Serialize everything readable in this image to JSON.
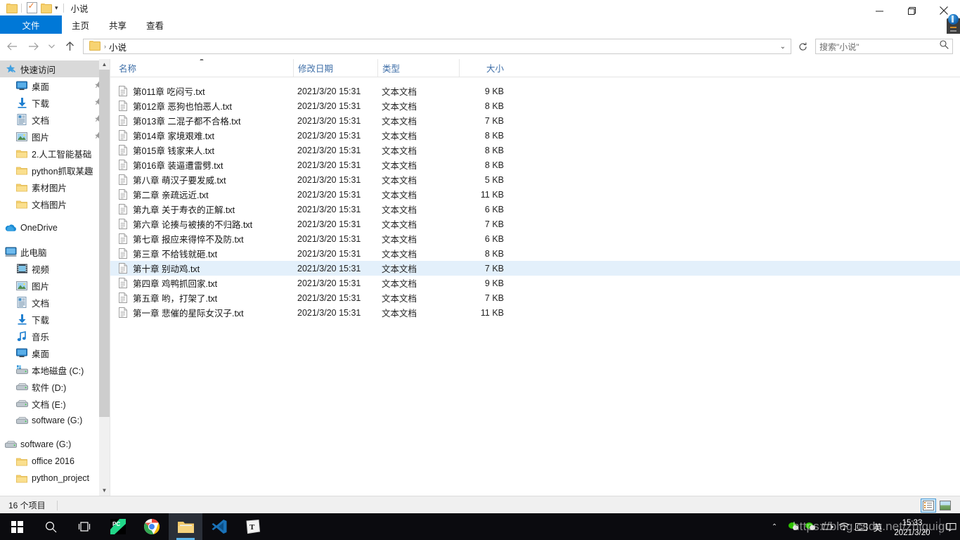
{
  "window": {
    "title": "小说",
    "quick_access_icons": [
      "folder-icon",
      "properties-checkbox-icon",
      "new-folder-icon",
      "customize-chevron-icon"
    ],
    "minimize_label": "—",
    "maximize_label": "❐",
    "close_label": "✕"
  },
  "ribbon": {
    "tabs": [
      {
        "label": "文件",
        "active": true
      },
      {
        "label": "主页",
        "active": false
      },
      {
        "label": "共享",
        "active": false
      },
      {
        "label": "查看",
        "active": false
      }
    ],
    "expand_icon": "chevron-down-icon"
  },
  "addressbar": {
    "back_icon": "arrow-left-icon",
    "forward_icon": "arrow-right-icon",
    "recent_icon": "chevron-down-icon",
    "up_icon": "arrow-up-icon",
    "breadcrumb_folder_icon": "folder-icon",
    "breadcrumb_separator": "›",
    "path": "小说",
    "dropdown_icon": "chevron-down-icon",
    "refresh_icon": "refresh-icon"
  },
  "search": {
    "placeholder": "搜索\"小说\"",
    "icon": "search-icon"
  },
  "sidebar": {
    "items": [
      {
        "label": "快速访问",
        "icon": "star-pin-icon",
        "indent": 0,
        "selected": true,
        "pinned": false
      },
      {
        "label": "桌面",
        "icon": "desktop-icon",
        "indent": 1,
        "selected": false,
        "pinned": true
      },
      {
        "label": "下载",
        "icon": "download-icon",
        "indent": 1,
        "selected": false,
        "pinned": true
      },
      {
        "label": "文档",
        "icon": "documents-icon",
        "indent": 1,
        "selected": false,
        "pinned": true
      },
      {
        "label": "图片",
        "icon": "pictures-icon",
        "indent": 1,
        "selected": false,
        "pinned": true
      },
      {
        "label": "2.人工智能基础",
        "icon": "folder-icon",
        "indent": 1,
        "selected": false,
        "pinned": false
      },
      {
        "label": "python抓取某趣",
        "icon": "folder-icon",
        "indent": 1,
        "selected": false,
        "pinned": false
      },
      {
        "label": "素材图片",
        "icon": "folder-icon",
        "indent": 1,
        "selected": false,
        "pinned": false
      },
      {
        "label": "文档图片",
        "icon": "folder-icon",
        "indent": 1,
        "selected": false,
        "pinned": false
      },
      {
        "label": "__GAP__",
        "icon": "",
        "indent": 0,
        "selected": false,
        "pinned": false
      },
      {
        "label": "OneDrive",
        "icon": "onedrive-icon",
        "indent": 0,
        "selected": false,
        "pinned": false
      },
      {
        "label": "__GAP__",
        "icon": "",
        "indent": 0,
        "selected": false,
        "pinned": false
      },
      {
        "label": "此电脑",
        "icon": "this-pc-icon",
        "indent": 0,
        "selected": false,
        "pinned": false
      },
      {
        "label": "视频",
        "icon": "videos-icon",
        "indent": 1,
        "selected": false,
        "pinned": false
      },
      {
        "label": "图片",
        "icon": "pictures-icon",
        "indent": 1,
        "selected": false,
        "pinned": false
      },
      {
        "label": "文档",
        "icon": "documents-icon",
        "indent": 1,
        "selected": false,
        "pinned": false
      },
      {
        "label": "下载",
        "icon": "download-icon",
        "indent": 1,
        "selected": false,
        "pinned": false
      },
      {
        "label": "音乐",
        "icon": "music-icon",
        "indent": 1,
        "selected": false,
        "pinned": false
      },
      {
        "label": "桌面",
        "icon": "desktop-icon",
        "indent": 1,
        "selected": false,
        "pinned": false
      },
      {
        "label": "本地磁盘 (C:)",
        "icon": "drive-system-icon",
        "indent": 1,
        "selected": false,
        "pinned": false
      },
      {
        "label": "软件 (D:)",
        "icon": "drive-icon",
        "indent": 1,
        "selected": false,
        "pinned": false
      },
      {
        "label": "文档 (E:)",
        "icon": "drive-icon",
        "indent": 1,
        "selected": false,
        "pinned": false
      },
      {
        "label": "software (G:)",
        "icon": "drive-icon",
        "indent": 1,
        "selected": false,
        "pinned": false
      },
      {
        "label": "__GAP__",
        "icon": "",
        "indent": 0,
        "selected": false,
        "pinned": false
      },
      {
        "label": "software (G:)",
        "icon": "drive-icon",
        "indent": 0,
        "selected": false,
        "pinned": false
      },
      {
        "label": "office 2016",
        "icon": "folder-icon",
        "indent": 1,
        "selected": false,
        "pinned": false
      },
      {
        "label": "python_project",
        "icon": "folder-icon",
        "indent": 1,
        "selected": false,
        "pinned": false
      }
    ],
    "scroll_up_icon": "chevron-up-icon",
    "scroll_down_icon": "chevron-down-icon"
  },
  "filelist": {
    "columns": [
      {
        "label": "名称",
        "sorted": true,
        "sort_icon": "sort-ascending-icon"
      },
      {
        "label": "修改日期",
        "sorted": false,
        "sort_icon": ""
      },
      {
        "label": "类型",
        "sorted": false,
        "sort_icon": ""
      },
      {
        "label": "大小",
        "sorted": false,
        "sort_icon": ""
      }
    ],
    "rows": [
      {
        "name": "第011章 吃闷亏.txt",
        "date": "2021/3/20 15:31",
        "type": "文本文档",
        "size": "9 KB",
        "selected": false
      },
      {
        "name": "第012章 恶狗也怕恶人.txt",
        "date": "2021/3/20 15:31",
        "type": "文本文档",
        "size": "8 KB",
        "selected": false
      },
      {
        "name": "第013章 二混子都不合格.txt",
        "date": "2021/3/20 15:31",
        "type": "文本文档",
        "size": "7 KB",
        "selected": false
      },
      {
        "name": "第014章 家境艰难.txt",
        "date": "2021/3/20 15:31",
        "type": "文本文档",
        "size": "8 KB",
        "selected": false
      },
      {
        "name": "第015章 钱家来人.txt",
        "date": "2021/3/20 15:31",
        "type": "文本文档",
        "size": "8 KB",
        "selected": false
      },
      {
        "name": "第016章 装逼遭雷劈.txt",
        "date": "2021/3/20 15:31",
        "type": "文本文档",
        "size": "8 KB",
        "selected": false
      },
      {
        "name": "第八章 萌汉子要发威.txt",
        "date": "2021/3/20 15:31",
        "type": "文本文档",
        "size": "5 KB",
        "selected": false
      },
      {
        "name": "第二章 亲疏远近.txt",
        "date": "2021/3/20 15:31",
        "type": "文本文档",
        "size": "11 KB",
        "selected": false
      },
      {
        "name": "第九章 关于寿衣的正解.txt",
        "date": "2021/3/20 15:31",
        "type": "文本文档",
        "size": "6 KB",
        "selected": false
      },
      {
        "name": "第六章 论揍与被揍的不归路.txt",
        "date": "2021/3/20 15:31",
        "type": "文本文档",
        "size": "7 KB",
        "selected": false
      },
      {
        "name": "第七章 报应来得悴不及防.txt",
        "date": "2021/3/20 15:31",
        "type": "文本文档",
        "size": "6 KB",
        "selected": false
      },
      {
        "name": "第三章 不给钱就砸.txt",
        "date": "2021/3/20 15:31",
        "type": "文本文档",
        "size": "8 KB",
        "selected": false
      },
      {
        "name": "第十章 别动鸡.txt",
        "date": "2021/3/20 15:31",
        "type": "文本文档",
        "size": "7 KB",
        "selected": true
      },
      {
        "name": "第四章 鸡鸭抓回家.txt",
        "date": "2021/3/20 15:31",
        "type": "文本文档",
        "size": "9 KB",
        "selected": false
      },
      {
        "name": "第五章 哟，打架了.txt",
        "date": "2021/3/20 15:31",
        "type": "文本文档",
        "size": "7 KB",
        "selected": false
      },
      {
        "name": "第一章 悲催的星际女汉子.txt",
        "date": "2021/3/20 15:31",
        "type": "文本文档",
        "size": "11 KB",
        "selected": false
      }
    ]
  },
  "statusbar": {
    "item_count": "16 个项目",
    "view_details_icon": "details-view-icon",
    "view_large_icons_icon": "large-icons-view-icon"
  },
  "taskbar": {
    "items": [
      {
        "name": "start-button",
        "icon": "windows-logo-icon",
        "running": false,
        "active": false
      },
      {
        "name": "search-button",
        "icon": "search-icon",
        "running": false,
        "active": false
      },
      {
        "name": "task-view-button",
        "icon": "task-view-icon",
        "running": false,
        "active": false
      },
      {
        "name": "pycharm",
        "icon": "pycharm-icon",
        "running": true,
        "active": false
      },
      {
        "name": "chrome",
        "icon": "chrome-icon",
        "running": true,
        "active": false
      },
      {
        "name": "file-explorer",
        "icon": "file-explorer-icon",
        "running": true,
        "active": true
      },
      {
        "name": "vscode",
        "icon": "vscode-icon",
        "running": true,
        "active": false
      },
      {
        "name": "typora",
        "icon": "typora-icon",
        "running": true,
        "active": false
      }
    ],
    "tray": {
      "overflow_icon": "chevron-up-icon",
      "icons": [
        "wechat-icon",
        "wechat-icon",
        "battery-icon",
        "wifi-icon",
        "keyboard-icon"
      ],
      "ime_label": "英",
      "time": "15:33",
      "date": "2021/3/20",
      "action_center_icon": "action-center-icon"
    }
  },
  "watermark": {
    "text": "https://blog.csdn.net/zhiguigu"
  },
  "colors": {
    "accent": "#0078d7",
    "selection": "#e3f0fb",
    "column_header": "#3f6fa8",
    "sidebar_selected": "#d9d9d9",
    "taskbar": "#0b0b0f",
    "taskbar_underline": "#5cb3e8",
    "folder_yellow": "#f7d372"
  }
}
